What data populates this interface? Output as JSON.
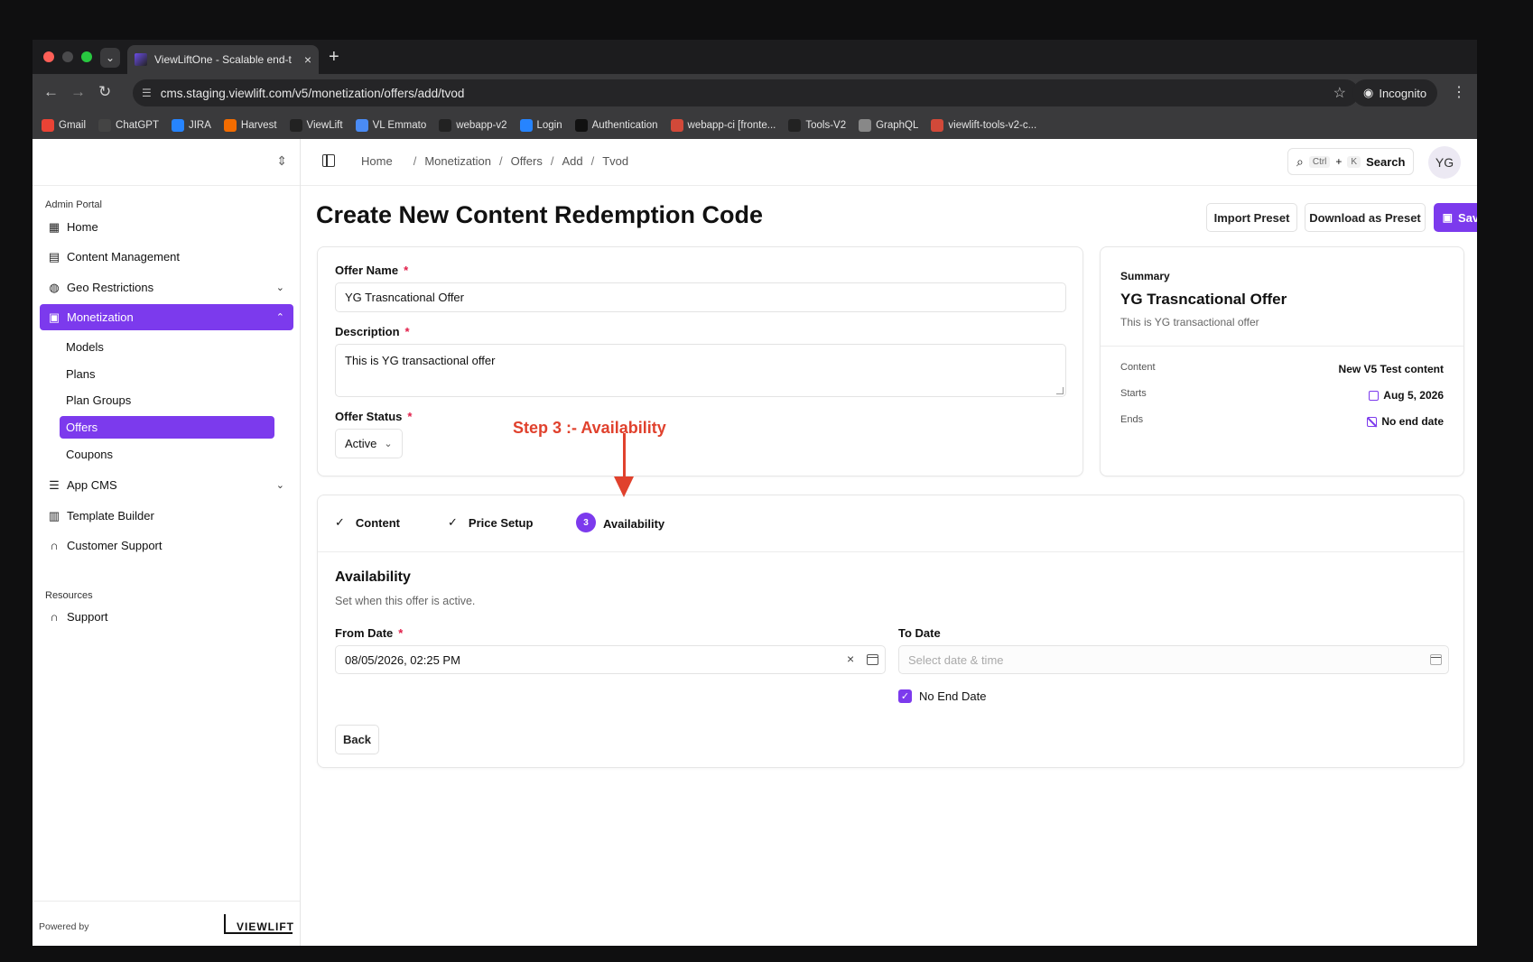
{
  "browser": {
    "tab_title": "ViewLiftOne - Scalable end-t",
    "url": "cms.staging.viewlift.com/v5/monetization/offers/add/tvod",
    "incognito_label": "Incognito",
    "bookmarks": [
      {
        "label": "Gmail",
        "icon": "gmail-icon",
        "color": "#ea4335"
      },
      {
        "label": "ChatGPT",
        "icon": "chatgpt-icon",
        "color": "#444444"
      },
      {
        "label": "JIRA",
        "icon": "jira-icon",
        "color": "#2684ff"
      },
      {
        "label": "Harvest",
        "icon": "harvest-icon",
        "color": "#f36c00"
      },
      {
        "label": "ViewLift",
        "icon": "github-icon",
        "color": "#222222"
      },
      {
        "label": "VL Emmato",
        "icon": "doc-icon",
        "color": "#4a8bf5"
      },
      {
        "label": "webapp-v2",
        "icon": "github-icon",
        "color": "#222222"
      },
      {
        "label": "Login",
        "icon": "jira-icon",
        "color": "#2684ff"
      },
      {
        "label": "Authentication",
        "icon": "app-icon",
        "color": "#111111"
      },
      {
        "label": "webapp-ci [fronte...",
        "icon": "jenkins-icon",
        "color": "#d24939"
      },
      {
        "label": "Tools-V2",
        "icon": "github-icon",
        "color": "#222222"
      },
      {
        "label": "GraphQL",
        "icon": "globe-icon",
        "color": "#888888"
      },
      {
        "label": "viewlift-tools-v2-c...",
        "icon": "jenkins-icon",
        "color": "#d24939"
      }
    ]
  },
  "sidebar": {
    "section_admin": "Admin Portal",
    "section_resources": "Resources",
    "items": [
      {
        "label": "Home",
        "icon": "grid-icon"
      },
      {
        "label": "Content Management",
        "icon": "film-icon"
      },
      {
        "label": "Geo Restrictions",
        "icon": "globe-icon"
      },
      {
        "label": "Monetization",
        "icon": "wallet-icon"
      },
      {
        "label": "App CMS",
        "icon": "sliders-icon"
      },
      {
        "label": "Template Builder",
        "icon": "layout-icon"
      },
      {
        "label": "Customer Support",
        "icon": "headset-icon"
      }
    ],
    "sub_items": [
      "Models",
      "Plans",
      "Plan Groups",
      "Offers",
      "Coupons"
    ],
    "support_label": "Support",
    "powered_by": "Powered by",
    "logo_text": "VIEWLIFT"
  },
  "header": {
    "breadcrumbs": [
      "Home",
      "Monetization",
      "Offers",
      "Add",
      "Tvod"
    ],
    "search_kbd_1": "Ctrl",
    "search_plus": "+",
    "search_kbd_2": "K",
    "search_label": "Search",
    "avatar": "YG"
  },
  "page": {
    "title": "Create New Content Redemption Code",
    "import_preset": "Import Preset",
    "download_preset": "Download as Preset",
    "save": "Save"
  },
  "form": {
    "offer_name_label": "Offer Name",
    "offer_name_value": "YG Trasncational Offer",
    "description_label": "Description",
    "description_value": "This is YG transactional offer",
    "status_label": "Offer Status",
    "status_value": "Active",
    "required_mark": "*"
  },
  "annotation": "Step 3 :- Availability",
  "summary": {
    "title": "Summary",
    "name": "YG Trasncational Offer",
    "description": "This is YG transactional offer",
    "content_key": "Content",
    "content_val": "New V5 Test content",
    "starts_key": "Starts",
    "starts_val": "Aug 5, 2026",
    "ends_key": "Ends",
    "ends_val": "No end date"
  },
  "steps": {
    "items": [
      "Content",
      "Price Setup",
      "Availability"
    ],
    "current_number": "3",
    "check": "✓"
  },
  "availability": {
    "title": "Availability",
    "subtitle": "Set when this offer is active.",
    "from_label": "From Date",
    "from_value": "08/05/2026, 02:25 PM",
    "to_label": "To Date",
    "to_placeholder": "Select date & time",
    "no_end_label": "No End Date",
    "no_end_checked": true,
    "back": "Back"
  },
  "colors": {
    "accent": "#7c3aed",
    "annotation": "#e0412d",
    "required": "#e11d48"
  }
}
